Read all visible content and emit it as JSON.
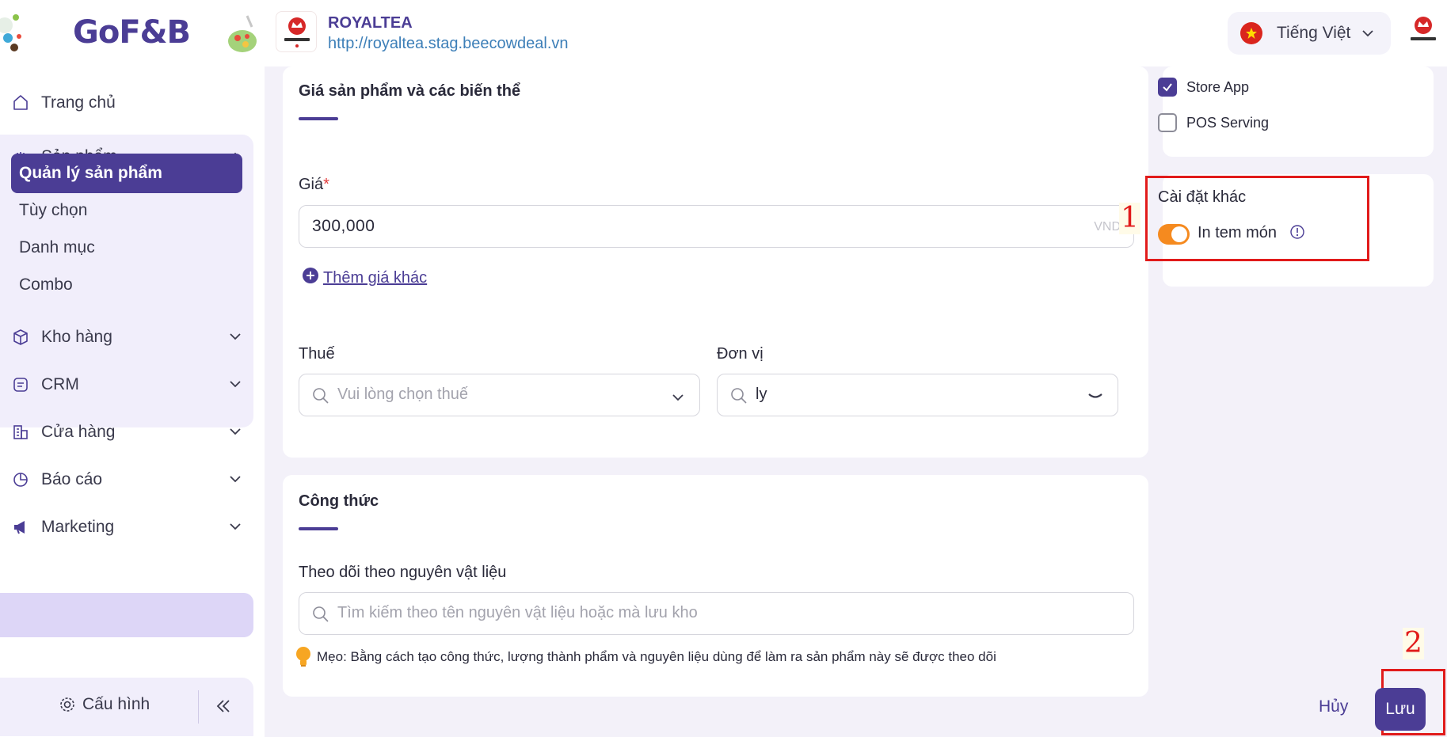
{
  "header": {
    "logo_text": "GoF&B",
    "store_name": "ROYALTEA",
    "store_url": "http://royaltea.stag.beecowdeal.vn",
    "language": "Tiếng Việt"
  },
  "sidebar": {
    "home": "Trang chủ",
    "products": "Sản phẩm",
    "product_sub": [
      "Quản lý sản phẩm",
      "Tùy chọn",
      "Danh mục",
      "Combo"
    ],
    "warehouse": "Kho hàng",
    "crm": "CRM",
    "store": "Cửa hàng",
    "reports": "Báo cáo",
    "marketing": "Marketing",
    "config": "Cấu hình"
  },
  "price_card": {
    "title": "Giá sản phẩm và các biến thể",
    "price_label": "Giá",
    "required_mark": "*",
    "price_value": "300,000",
    "currency": "VND",
    "add_price": "Thêm giá khác",
    "tax_label": "Thuế",
    "tax_placeholder": "Vui lòng chọn thuế",
    "unit_label": "Đơn vị",
    "unit_value": "ly"
  },
  "recipe_card": {
    "title": "Công thức",
    "track_label": "Theo dõi theo nguyên vật liệu",
    "search_placeholder": "Tìm kiếm theo tên nguyên vật liệu hoặc mà lưu kho",
    "tip": "Mẹo: Bằng cách tạo công thức, lượng thành phẩm và nguyên liệu dùng để làm ra sản phẩm này sẽ được theo dõi"
  },
  "platforms": {
    "store_app": "Store App",
    "store_app_checked": true,
    "pos_serving": "POS Serving",
    "pos_serving_checked": false
  },
  "other_settings": {
    "title": "Cài đặt khác",
    "print_label": "In tem món",
    "print_enabled": true
  },
  "annotations": [
    "1",
    "2"
  ],
  "actions": {
    "cancel": "Hủy",
    "save": "Lưu"
  },
  "colors": {
    "primary": "#4b3d95",
    "toggle_on": "#f58a1f",
    "annotation": "#e11b1b",
    "link": "#3d7fb8"
  }
}
